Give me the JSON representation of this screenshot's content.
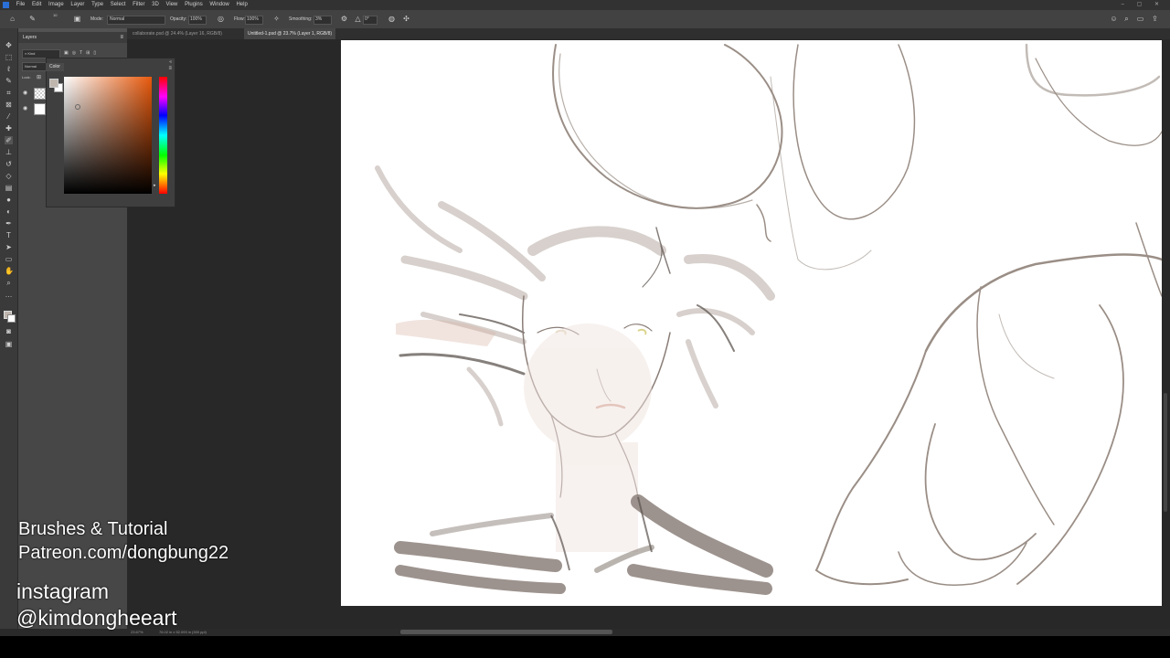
{
  "menubar": {
    "items": [
      "File",
      "Edit",
      "Image",
      "Layer",
      "Type",
      "Select",
      "Filter",
      "3D",
      "View",
      "Plugins",
      "Window",
      "Help"
    ]
  },
  "options_bar": {
    "mode_label": "Mode:",
    "mode_value": "Normal",
    "opacity_label": "Opacity:",
    "opacity_value": "100%",
    "flow_label": "Flow:",
    "flow_value": "100%",
    "smoothing_label": "Smoothing:",
    "smoothing_value": "3%",
    "angle_value": "0°",
    "brush_size": "10"
  },
  "tabs": [
    {
      "label": "collaborate.psd @ 24.4% (Layer 16, RGB/8)"
    },
    {
      "label": "Untitled-1.psd @ 23.7% (Layer 1, RGB/8)"
    }
  ],
  "layers_panel": {
    "title": "Layers",
    "kind_label": "Kind",
    "blend_mode": "Normal",
    "locks_label": "Lock:"
  },
  "color_panel": {
    "title": "Color",
    "foreground": "#bfb6ae",
    "background": "#ffffff",
    "hue_color": "#e8590c"
  },
  "status_bar": {
    "zoom": "23.67%",
    "doc_info": "76.02 in x 52.093 in (300 ppi)"
  },
  "overlay": {
    "line1": "Brushes & Tutorial",
    "line2": "Patreon.com/dongbung22",
    "line3": "instagram",
    "line4": "@kimdongheeart"
  },
  "toolbar_icons": [
    "move-icon",
    "marquee-icon",
    "lasso-icon",
    "quick-select-icon",
    "crop-icon",
    "frame-icon",
    "eyedropper-icon",
    "healing-icon",
    "brush-icon",
    "stamp-icon",
    "history-brush-icon",
    "eraser-icon",
    "gradient-icon",
    "blur-icon",
    "dodge-icon",
    "pen-icon",
    "type-icon",
    "path-select-icon",
    "shape-icon",
    "hand-icon",
    "zoom-icon",
    "more-icon",
    "swatches-icon",
    "quickmask-icon",
    "screenmode-icon"
  ]
}
